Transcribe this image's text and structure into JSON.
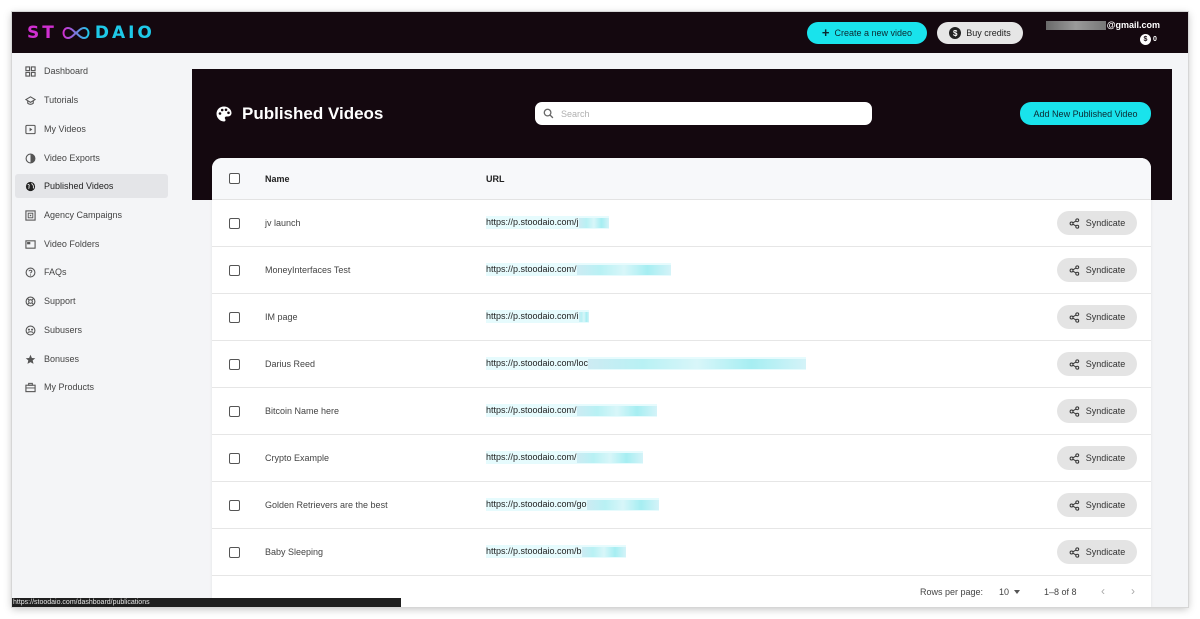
{
  "topbar": {
    "logo": {
      "part1": "ST",
      "part2": "DAIO"
    },
    "create_label": "Create a new video",
    "buy_label": "Buy credits",
    "user_email_suffix": "@gmail.com",
    "credits": "0"
  },
  "sidebar": {
    "items": [
      {
        "label": "Dashboard",
        "icon": "dashboard-icon"
      },
      {
        "label": "Tutorials",
        "icon": "graduation-cap-icon"
      },
      {
        "label": "My Videos",
        "icon": "video-icon"
      },
      {
        "label": "Video Exports",
        "icon": "export-icon"
      },
      {
        "label": "Published Videos",
        "icon": "globe-icon",
        "active": true
      },
      {
        "label": "Agency Campaigns",
        "icon": "campaign-icon"
      },
      {
        "label": "Video Folders",
        "icon": "folder-icon"
      },
      {
        "label": "FAQs",
        "icon": "help-icon"
      },
      {
        "label": "Support",
        "icon": "support-icon"
      },
      {
        "label": "Subusers",
        "icon": "users-icon"
      },
      {
        "label": "Bonuses",
        "icon": "star-icon"
      },
      {
        "label": "My Products",
        "icon": "briefcase-icon"
      }
    ]
  },
  "page": {
    "title": "Published Videos",
    "search_placeholder": "Search",
    "add_label": "Add New Published Video"
  },
  "table": {
    "headers": {
      "name": "Name",
      "url": "URL"
    },
    "syndicate_label": "Syndicate",
    "rows": [
      {
        "name": "jv launch",
        "url": "https://p.stoodaio.com/j"
      },
      {
        "name": "MoneyInterfaces Test",
        "url": "https://p.stoodaio.com/"
      },
      {
        "name": "IM page",
        "url": "https://p.stoodaio.com/i"
      },
      {
        "name": "Darius Reed",
        "url": "https://p.stoodaio.com/loc"
      },
      {
        "name": "Bitcoin Name here",
        "url": "https://p.stoodaio.com/"
      },
      {
        "name": "Crypto Example",
        "url": "https://p.stoodaio.com/"
      },
      {
        "name": "Golden Retrievers are the best",
        "url": "https://p.stoodaio.com/go"
      },
      {
        "name": "Baby Sleeping",
        "url": "https://p.stoodaio.com/b"
      }
    ]
  },
  "pagination": {
    "rows_per_page_label": "Rows per page:",
    "rows_per_page": "10",
    "range": "1–8 of 8"
  },
  "statusbar": {
    "url": "https://stoodaio.com/dashboard/publications"
  },
  "colors": {
    "accent": "#19e3ec",
    "topbar_bg": "#14080f"
  }
}
